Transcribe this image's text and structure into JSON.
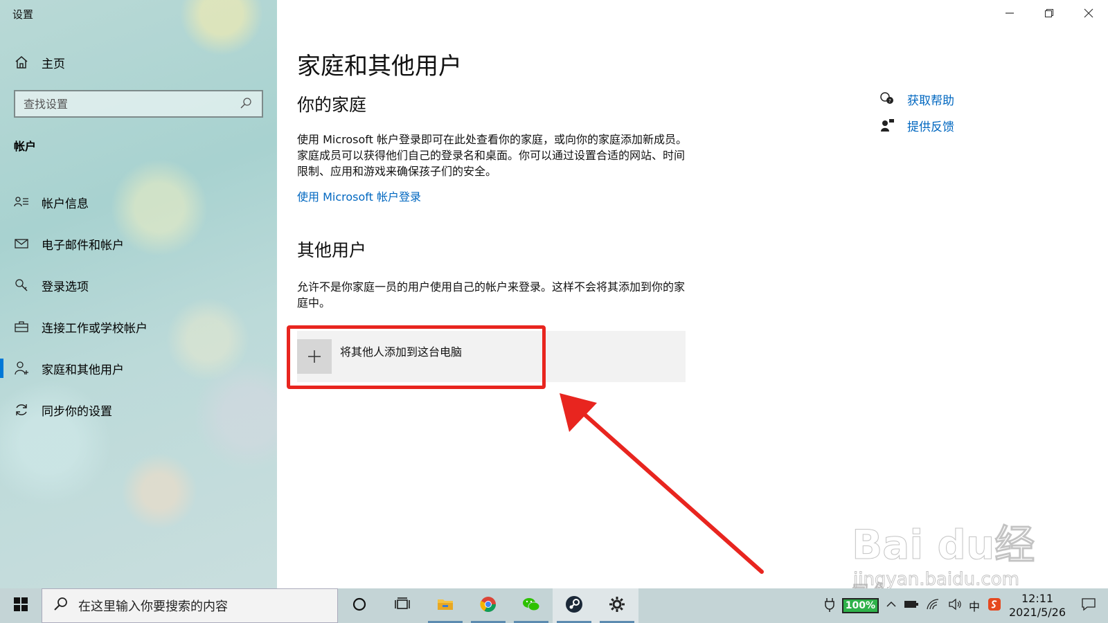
{
  "window": {
    "title": "设置"
  },
  "sidebar": {
    "home_label": "主页",
    "search_placeholder": "查找设置",
    "section_title": "帐户",
    "items": [
      {
        "label": "帐户信息",
        "icon": "account-info-icon",
        "active": false
      },
      {
        "label": "电子邮件和帐户",
        "icon": "mail-icon",
        "active": false
      },
      {
        "label": "登录选项",
        "icon": "key-icon",
        "active": false
      },
      {
        "label": "连接工作或学校帐户",
        "icon": "briefcase-icon",
        "active": false
      },
      {
        "label": "家庭和其他用户",
        "icon": "user-add-icon",
        "active": true
      },
      {
        "label": "同步你的设置",
        "icon": "sync-icon",
        "active": false
      }
    ]
  },
  "main": {
    "title": "家庭和其他用户",
    "family": {
      "heading": "你的家庭",
      "description": "使用 Microsoft 帐户登录即可在此处查看你的家庭，或向你的家庭添加新成员。家庭成员可以获得他们自己的登录名和桌面。你可以通过设置合适的网站、时间限制、应用和游戏来确保孩子们的安全。",
      "link": "使用 Microsoft 帐户登录"
    },
    "other": {
      "heading": "其他用户",
      "description": "允许不是你家庭一员的用户使用自己的帐户来登录。这样不会将其添加到你的家庭中。",
      "add_label": "将其他人添加到这台电脑"
    },
    "help": {
      "get_help": "获取帮助",
      "feedback": "提供反馈"
    },
    "highlight_color": "#e8251f",
    "link_color": "#0067c0"
  },
  "watermark": {
    "brand": "Bai du经验",
    "url": "jingyan.baidu.com"
  },
  "taskbar": {
    "search_placeholder": "在这里输入你要搜索的内容",
    "apps": [
      "cortana-icon",
      "task-view-icon",
      "file-explorer-icon",
      "chrome-icon",
      "wechat-icon",
      "steam-icon",
      "settings-icon"
    ],
    "battery": "100%",
    "ime": "中",
    "time": "12:11",
    "date": "2021/5/26"
  }
}
